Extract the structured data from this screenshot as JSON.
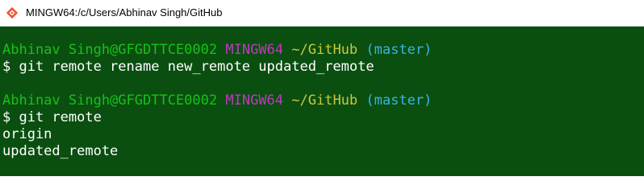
{
  "window": {
    "title": "MINGW64:/c/Users/Abhinav Singh/GitHub",
    "icon": "git-bash-icon"
  },
  "colors": {
    "terminal_bg": "#0a4f10",
    "user_host": "#18c018",
    "env": "#c038c0",
    "path": "#c8c83a",
    "branch": "#3ab4e0",
    "text": "#ffffff"
  },
  "terminal": {
    "prompt1": {
      "user_host": "Abhinav Singh@GFGDTTCE0002",
      "env": "MINGW64",
      "path": "~/GitHub",
      "branch": "(master)"
    },
    "command1": "$ git remote rename new_remote updated_remote",
    "prompt2": {
      "user_host": "Abhinav Singh@GFGDTTCE0002",
      "env": "MINGW64",
      "path": "~/GitHub",
      "branch": "(master)"
    },
    "command2": "$ git remote",
    "output": [
      "origin",
      "updated_remote"
    ]
  }
}
